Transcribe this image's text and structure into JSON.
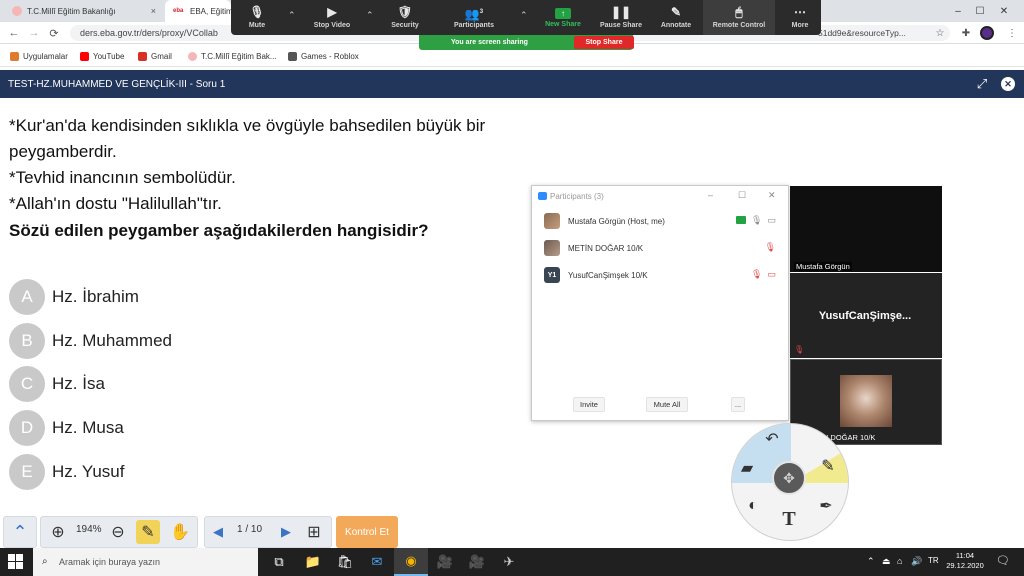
{
  "browser": {
    "tabs": [
      {
        "label": "T.C.Millî Eğitim Bakanlığı"
      },
      {
        "label": "EBA, Eğitim"
      }
    ],
    "tab_close": "×",
    "window_controls": {
      "minimize": "–",
      "maximize": "☐",
      "close": "✕"
    },
    "nav": {
      "back": "←",
      "forward": "→",
      "reload": "⟳"
    },
    "url": "ders.eba.gov.tr/ders/proxy/VCollab",
    "url_tail": "51dd9e&resourceTyp...",
    "bookmarks": [
      {
        "label": "Uygulamalar",
        "color": "#e07a2f"
      },
      {
        "label": "YouTube",
        "color": "#ff0000"
      },
      {
        "label": "Gmail",
        "color": "#d93025"
      },
      {
        "label": "T.C.Millî Eğitim Bak...",
        "color": "#f4b6b6"
      },
      {
        "label": "Games - Roblox",
        "color": "#555555"
      }
    ]
  },
  "zoom": {
    "controls": [
      {
        "label": "Mute",
        "icon": "🎙"
      },
      {
        "label": "Stop Video",
        "icon": "▶"
      },
      {
        "label": "Security",
        "icon": "🛡"
      },
      {
        "label": "Participants",
        "icon": "👥",
        "count": "3"
      },
      {
        "label": "New Share",
        "icon": "↑"
      },
      {
        "label": "Pause Share",
        "icon": "❚❚"
      },
      {
        "label": "Annotate",
        "icon": "✎"
      },
      {
        "label": "Remote Control",
        "icon": "🖱"
      },
      {
        "label": "More",
        "icon": "⋯"
      }
    ],
    "chevron": "⌃",
    "sharing_text": "You are screen sharing",
    "stop_share": "Stop Share"
  },
  "test": {
    "title": "TEST-HZ.MUHAMMED VE GENÇLİK-III - Soru 1",
    "expand_icon": "⤢",
    "close_icon": "✕",
    "question_lines": [
      "*Kur'an'da kendisinden sıklıkla ve övgüyle bahsedilen büyük bir",
      "peygamberdir.",
      "*Tevhid inancının sembolüdür.",
      "*Allah'ın dostu \"Halilullah\"tır."
    ],
    "question_prompt": "Sözü edilen peygamber aşağıdakilerden hangisidir?",
    "options": [
      {
        "letter": "A",
        "text": "Hz. İbrahim"
      },
      {
        "letter": "B",
        "text": "Hz. Muhammed"
      },
      {
        "letter": "C",
        "text": "Hz. İsa"
      },
      {
        "letter": "D",
        "text": "Hz. Musa"
      },
      {
        "letter": "E",
        "text": "Hz. Yusuf"
      }
    ],
    "toolbar": {
      "collapse_icon": "⌃",
      "zoom_in_icon": "⊕",
      "zoom_level": "194%",
      "zoom_out_icon": "⊖",
      "pencil_icon": "✎",
      "hand_icon": "✋",
      "prev_icon": "◀",
      "page": "1 / 10",
      "next_icon": "▶",
      "add_page_icon": "⊞",
      "kontrol_label": "Kontrol Et"
    }
  },
  "participants_panel": {
    "title": "Participants (3)",
    "win_min": "–",
    "win_max": "☐",
    "win_close": "✕",
    "participants": [
      {
        "name": "Mustafa Görgün (Host, me)"
      },
      {
        "name": "METİN DOĞAR 10/K"
      },
      {
        "name": "YusufCanŞimşek 10/K",
        "initials": "Y1"
      }
    ],
    "buttons": {
      "invite": "Invite",
      "mute_all": "Mute All",
      "more": "..."
    }
  },
  "video_tiles": {
    "tile1_name": "Mustafa Görgün",
    "tile2_name": "YusufCanŞimşe...",
    "tile3_name": "METİN DOĞAR 10/K",
    "mute_icon": "🎙"
  },
  "annotation_menu": {
    "undo_icon": "↶",
    "eraser_icon": "▰",
    "pencil_icon": "✎",
    "pen_icon": "✒",
    "spotlight_icon": "◐",
    "text_icon": "T",
    "move_icon": "✥"
  },
  "taskbar": {
    "search_placeholder": "Aramak için buraya yazın",
    "search_icon": "⌕",
    "time": "11:04",
    "date": "29.12.2020",
    "apps": [
      {
        "name": "task-view",
        "icon": "⧉"
      },
      {
        "name": "file-explorer",
        "icon": "📁"
      },
      {
        "name": "store",
        "icon": "🛍"
      },
      {
        "name": "mail",
        "icon": "✉"
      },
      {
        "name": "chrome",
        "icon": "◉"
      },
      {
        "name": "zoom",
        "icon": "🎥"
      },
      {
        "name": "zoom-meeting",
        "icon": "🎥"
      },
      {
        "name": "tool",
        "icon": "✈"
      }
    ],
    "tray": {
      "chevron": "⌃",
      "usb": "⏏",
      "network": "⌂",
      "volume": "🔊",
      "language": "TR",
      "notifications": "🗨"
    }
  }
}
